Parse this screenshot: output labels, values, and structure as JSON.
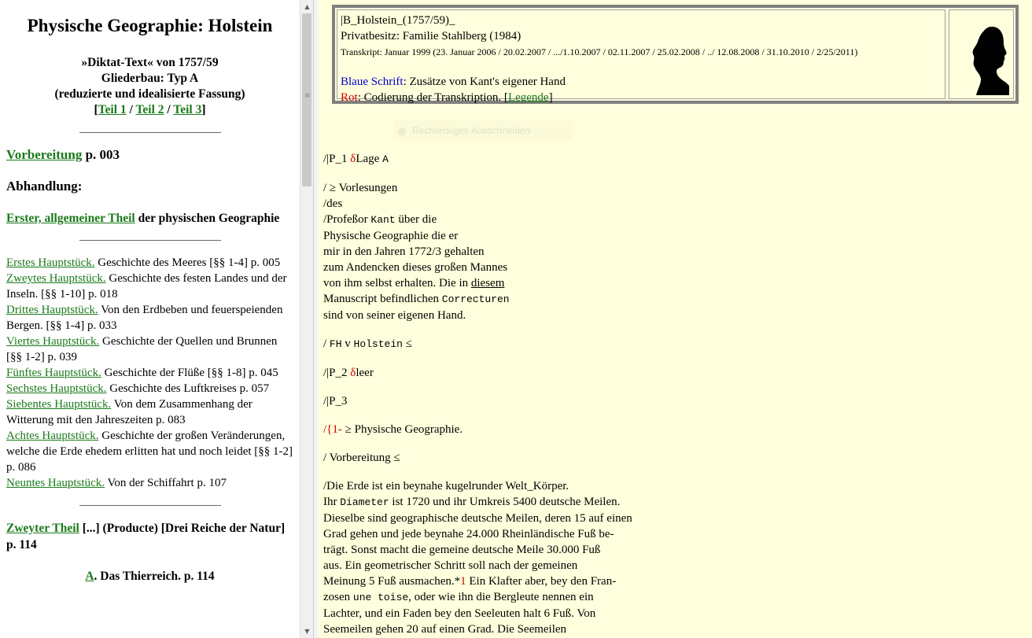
{
  "left": {
    "title": "Physische Geographie: Holstein",
    "subtitle_1": "»Diktat-Text« von 1757/59",
    "subtitle_2": "Gliederbau: Typ A",
    "subtitle_3": "(reduzierte und idealisierte Fassung)",
    "parts_open": "[",
    "part_1": "Teil 1",
    "part_sep": " / ",
    "part_2": "Teil 2",
    "part_3": "Teil 3",
    "parts_close": "]",
    "vorbereitung_link": "Vorbereitung",
    "vorbereitung_page": " p. 003",
    "abhandlung": "Abhandlung:",
    "erster_link": "Erster, allgemeiner Theil",
    "erster_rest": " der physischen Geographie",
    "toc": [
      {
        "link": "Erstes Hauptstück.",
        "text": " Geschichte des Meeres [§§ 1-4] p. 005"
      },
      {
        "link": "Zweytes Hauptstück.",
        "text": " Geschichte des festen Landes und der Inseln. [§§ 1-10] p. 018"
      },
      {
        "link": "Drittes Hauptstück.",
        "text": " Von den Erdbeben und feuerspeienden Bergen. [§§ 1-4] p. 033"
      },
      {
        "link": "Viertes Hauptstück.",
        "text": " Geschichte der Quellen und Brunnen [§§ 1-2] p. 039"
      },
      {
        "link": "Fünftes Hauptstück.",
        "text": " Geschichte der Flüße [§§ 1-8] p. 045"
      },
      {
        "link": "Sechstes Hauptstück.",
        "text": " Geschichte des Luftkreises p. 057"
      },
      {
        "link": "Siebentes Hauptstück.",
        "text": " Von dem Zusammenhang der Witterung mit den Jahreszeiten p. 083"
      },
      {
        "link": "Achtes Hauptstück.",
        "text": " Geschichte der großen Veränderungen, welche die Erde ehedem erlitten hat und noch leidet [§§ 1-2] p. 086"
      },
      {
        "link": "Neuntes Hauptstück.",
        "text": " Von der Schiffahrt p. 107"
      }
    ],
    "zweyter_link": "Zweyter Theil",
    "zweyter_rest": " [...] (Producte) [Drei Reiche der Natur] p. 114",
    "reich_link": "A",
    "reich_rest": ". Das Thierreich. p. 114"
  },
  "header": {
    "line1": "|B_Holstein_(1757/59)_",
    "line2": "Privatbesitz: Familie Stahlberg (1984)",
    "line3": "Transkript: Januar 1999 (23. Januar 2006 / 20.02.2007 / .../1.10.2007 / 02.11.2007 / 25.02.2008 / ../ 12.08.2008 / 31.10.2010 / 2/25/2011)",
    "blue_label": "Blaue Schrift",
    "blue_rest": ": Zusätze von Kant's eigener Hand",
    "red_label": "Rot",
    "red_rest": ": Codierung der Transkription. [",
    "legend_link": "Legende",
    "legend_close": "]"
  },
  "ghost_menu": "Rechteckiges Ausschneiden",
  "body": {
    "p1_a": "/|P_1 ",
    "p1_delta": "δ",
    "p1_b": "Lage ",
    "p1_mono": "A",
    "p2_l1": "/ ≥ Vorlesungen",
    "p2_l2": "/des",
    "p2_l3a": "/Profeßor ",
    "p2_l3mono": "Kant",
    "p2_l3b": " über die",
    "p2_l4": "Physische Geographie die er",
    "p2_l5": "mir in den Jahren 1772/3 gehalten",
    "p2_l6": "zum Andencken dieses großen Mannes",
    "p2_l7a": "von ihm selbst erhalten. Die in ",
    "p2_l7u": "diesem",
    "p2_l8a": "Manuscript befindlichen ",
    "p2_l8mono": "Correcturen",
    "p2_l9": "sind von seiner eigenen Hand.",
    "p3_a": "/ ",
    "p3_mono1": "FH",
    "p3_b": " v ",
    "p3_mono2": "Holstein",
    "p3_c": " ≤",
    "p4_a": "/|P_2 ",
    "p4_delta": "δ",
    "p4_b": "leer",
    "p5": "/|P_3",
    "p6_red": "/{1-",
    "p6_b": " ≥ Physische Geographie.",
    "p7": "/ Vorbereitung ≤",
    "p8_l1": "/Die Erde ist ein beynahe kugelrunder Welt_Körper.",
    "p8_l2a": "Ihr ",
    "p8_l2mono": "Diameter",
    "p8_l2b": " ist 1720 und ihr Umkreis 5400 deutsche Meilen.",
    "p8_l3": "Dieselbe sind geographische deutsche Meilen, deren 15 auf einen",
    "p8_l4": "Grad gehen und jede beynahe 24.000 Rheinländische Fuß be-",
    "p8_l5": "trägt. Sonst macht die gemeine deutsche Meile 30.000 Fuß",
    "p8_l6": "aus. Ein geometrischer Schritt soll nach der gemeinen",
    "p8_l7a": "Meinung 5 Fuß ausmachen.*",
    "p8_l7red": "1",
    "p8_l7b": " Ein Klafter aber, bey den Fran-",
    "p8_l8a": "zosen ",
    "p8_l8mono": "une toise",
    "p8_l8b": ", oder wie ihn die Bergleute nennen ein",
    "p8_l9": "Lachter, und ein Faden bey den Seeleuten halt 6 Fuß. Von",
    "p8_l10": "Seemeilen gehen 20 auf einen Grad. Die Seemeilen"
  },
  "colors": {
    "link": "#1a7a1a",
    "coding_red": "#d40000",
    "kant_blue": "#0000d0",
    "right_bg": "#ffffdd"
  }
}
